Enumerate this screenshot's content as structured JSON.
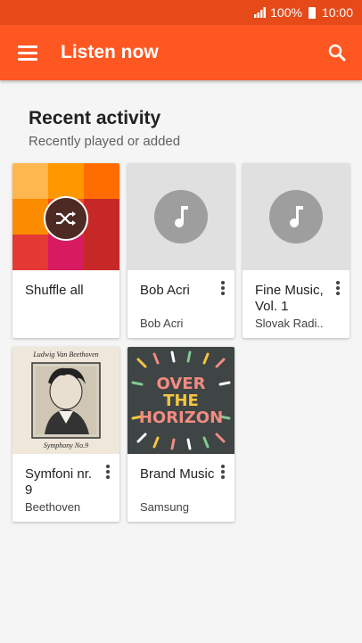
{
  "status": {
    "battery": "100%",
    "time": "10:00"
  },
  "appbar": {
    "title": "Listen now"
  },
  "section": {
    "title": "Recent activity",
    "subtitle": "Recently played or added"
  },
  "cards": [
    {
      "title": "Shuffle all",
      "subtitle": ""
    },
    {
      "title": "Bob Acri",
      "subtitle": "Bob Acri"
    },
    {
      "title": "Fine Music, Vol. 1",
      "subtitle": "Slovak Radi.."
    },
    {
      "title": "Symfoni nr. 9",
      "subtitle": "Beethoven"
    },
    {
      "title": "Brand Music",
      "subtitle": "Samsung"
    }
  ],
  "art": {
    "beethoven": {
      "name": "Ludwig Van Beethoven",
      "caption": "Symphony No.9"
    },
    "horizon": {
      "line1": "OVER",
      "line2": "THE",
      "line3": "HORIZON"
    }
  },
  "colors": {
    "primary": "#ff5722",
    "status": "#e64a19"
  },
  "shuffle_tile_colors": [
    "#ffb74d",
    "#ff9800",
    "#ff6d00",
    "#fb8c00",
    "#f4511e",
    "#c62828",
    "#e53935",
    "#d81b60",
    "#c62828"
  ]
}
